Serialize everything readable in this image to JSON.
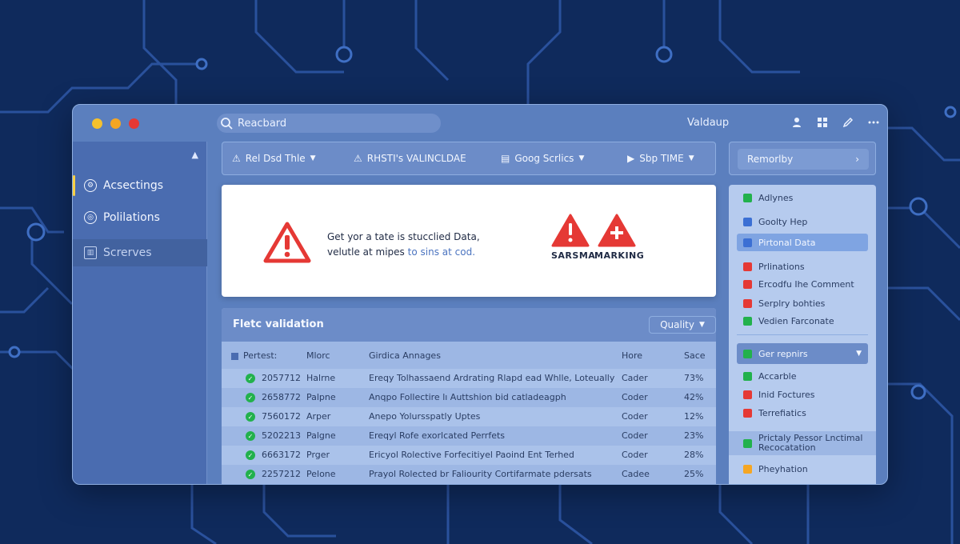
{
  "colors": {
    "background": "#0f2a5c",
    "window": "#5b7fbe",
    "accent_yellow": "#f7d046",
    "warning_red": "#e53935",
    "ok_green": "#22b14c"
  },
  "titlebar": {
    "search_value": "Reacbard",
    "app_title": "Valdaup",
    "icons": [
      "user-icon",
      "grid-icon",
      "pen-icon",
      "more-icon"
    ]
  },
  "sidebar": {
    "items": [
      {
        "label": "Acsectings",
        "icon": "settings-circle-icon"
      },
      {
        "label": "Polilations",
        "icon": "circle-icon"
      },
      {
        "label": "Screrves",
        "icon": "chart-icon"
      }
    ]
  },
  "toolbar": {
    "items": [
      {
        "label": "Rel Dsd Thle",
        "icon": "warning-icon",
        "has_caret": true
      },
      {
        "label": "RHSTI's VALINCLDAE",
        "icon": "warning-icon",
        "has_caret": false
      },
      {
        "label": "Goog Scrlics",
        "icon": "document-icon",
        "has_caret": true
      },
      {
        "label": "Sbp TIME",
        "icon": "play-icon",
        "has_caret": true
      }
    ]
  },
  "alert": {
    "line1": "Get yor a tate is stucclied Data,",
    "line2_prefix": "velutle at mipes",
    "line2_accent": "to sins at cod.",
    "label1": "SARSMA",
    "label2": "MARKING"
  },
  "validation": {
    "title": "Fletc validation",
    "quality_label": "Quality",
    "columns": [
      "Pertest:",
      "Mlorc",
      "Girdica Annages",
      "Hore",
      "Sace"
    ],
    "rows": [
      {
        "id": "2057712",
        "name": "Halrne",
        "desc": "Ereqy Tolhassaend Ardrating Rlapd ead Whlle, Loteually",
        "type": "Cader",
        "score": "73%"
      },
      {
        "id": "2658772",
        "name": "Palpne",
        "desc": "Anqpo Follectire lı Auttshion bid catladeagph",
        "type": "Coder",
        "score": "42%"
      },
      {
        "id": "7560172",
        "name": "Arper",
        "desc": "Anepo Yolursspatly Uptes",
        "type": "Coder",
        "score": "12%"
      },
      {
        "id": "5202213",
        "name": "Palgne",
        "desc": "Ereqyl Rofe exorlcated Perrfets",
        "type": "Coder",
        "score": "23%"
      },
      {
        "id": "6663172",
        "name": "Prger",
        "desc": "Ericyol Rolective Forfecitiyel Paoind Ent Terhed",
        "type": "Coder",
        "score": "28%"
      },
      {
        "id": "2257212",
        "name": "Pelone",
        "desc": "Prayol Rolected br Faliourity Cortifarmate pdersats",
        "type": "Cadee",
        "score": "25%"
      }
    ]
  },
  "right_panel": {
    "header_button": "Remorlby",
    "items": [
      {
        "label": "Adlynes",
        "color": "#22b14c"
      },
      {
        "label": "Goolty Hep",
        "color": "#3b6fd4"
      },
      {
        "label": "Pirtonal Data",
        "color": "#3b6fd4",
        "selected": true
      },
      {
        "label": "Prlinations",
        "color": "#e53935"
      },
      {
        "label": "Ercodfu Ihe Comment",
        "color": "#e53935"
      },
      {
        "label": "Serplry bohties",
        "color": "#e53935"
      },
      {
        "label": "Vedien Farconate",
        "color": "#22b14c"
      }
    ],
    "group_label": "Ger repnirs",
    "group_items": [
      {
        "label": "Accarble",
        "color": "#22b14c"
      },
      {
        "label": "Inid Foctures",
        "color": "#e53935"
      },
      {
        "label": "Terrefiatics",
        "color": "#e53935"
      }
    ],
    "block_label_line1": "Prictaly Pessor Lnctimal",
    "block_label_line2": "Recocatation",
    "last_item": "Pheyhation"
  }
}
